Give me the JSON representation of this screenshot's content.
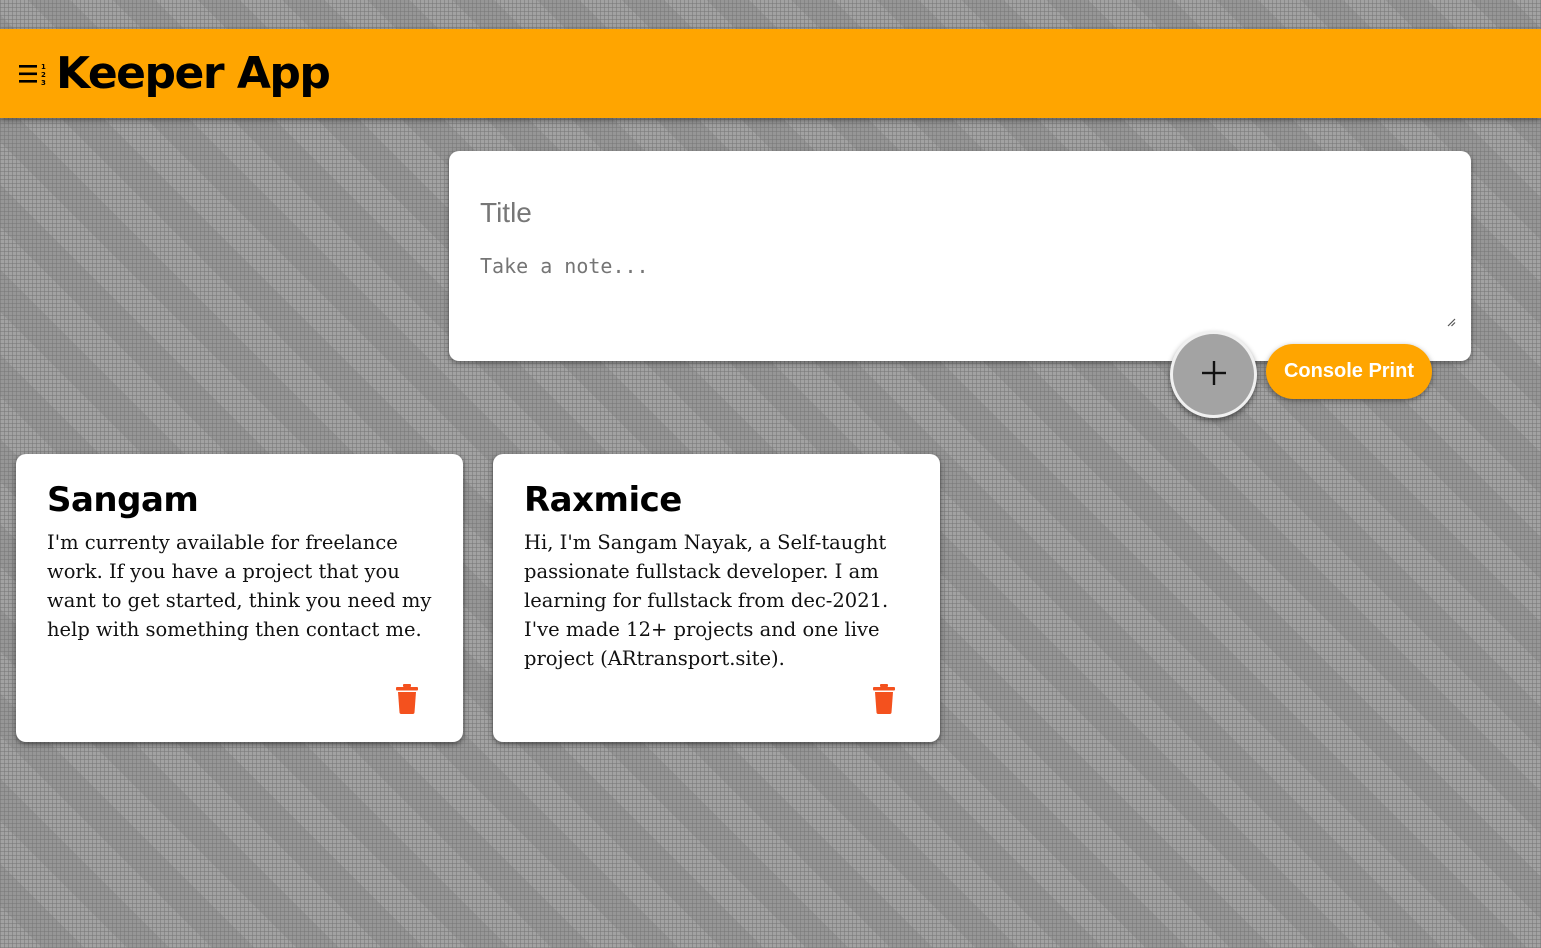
{
  "colors": {
    "accent": "#ffa500",
    "delete_icon": "#f4511e",
    "card_bg": "#ffffff"
  },
  "header": {
    "icon": "numbered-list-icon",
    "title": "Keeper App"
  },
  "composer": {
    "title_placeholder": "Title",
    "note_placeholder": "Take a note...",
    "add_icon": "plus-icon",
    "console_button_label": "Console Print"
  },
  "notes": [
    {
      "title": "Sangam",
      "content": "I'm currenty available for freelance work. If you have a project that you want to get started, think you need my help with something then contact me.",
      "delete_icon": "trash-icon"
    },
    {
      "title": "Raxmice",
      "content": "Hi, I'm Sangam Nayak, a Self-taught passionate fullstack developer. I am learning for fullstack from dec-2021. I've made 12+ projects and one live project (ARtransport.site).",
      "delete_icon": "trash-icon"
    }
  ]
}
